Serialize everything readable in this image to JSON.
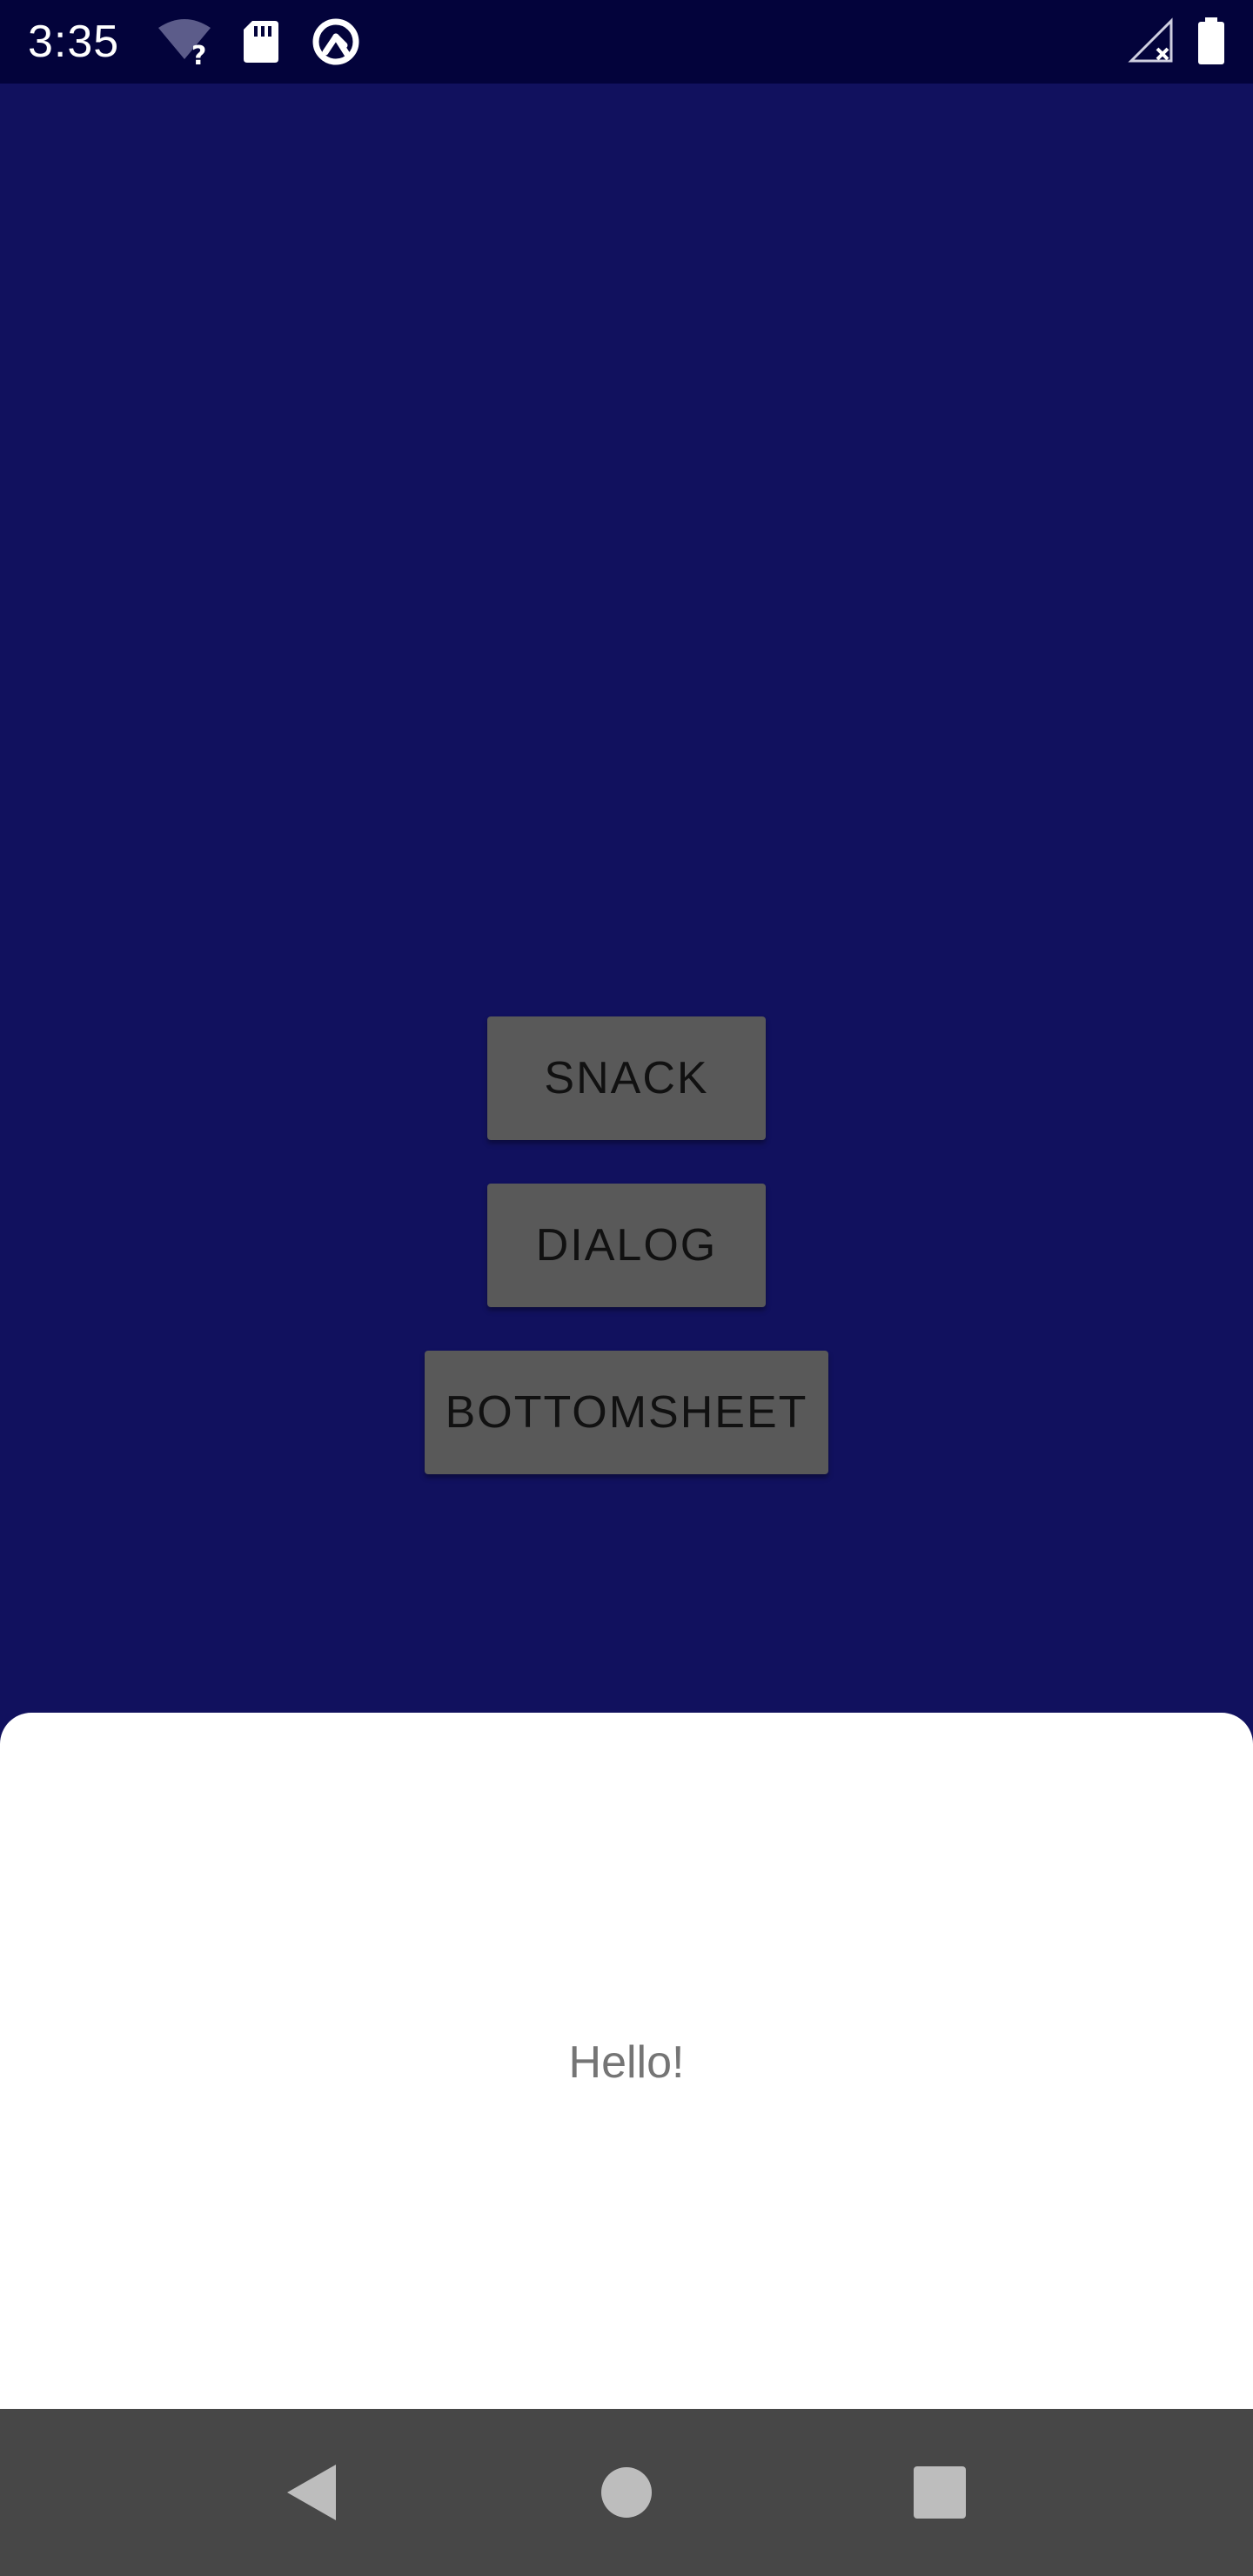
{
  "status_bar": {
    "time": "3:35",
    "icons": [
      "wifi-unknown-icon",
      "sd-card-icon",
      "sync-icon",
      "signal-off-icon",
      "battery-icon"
    ]
  },
  "main": {
    "buttons": {
      "snack": "SNACK",
      "dialog": "DIALOG",
      "bottomsheet": "BOTTOMSHEET"
    }
  },
  "bottom_sheet": {
    "text": "Hello!"
  },
  "nav_bar": {
    "icons": [
      "back-icon",
      "home-icon",
      "recents-icon"
    ]
  },
  "colors": {
    "status_bar": "#03033b",
    "background": "#11115e",
    "button": "#595959",
    "sheet": "#ffffff",
    "nav_bar": "#474747"
  }
}
